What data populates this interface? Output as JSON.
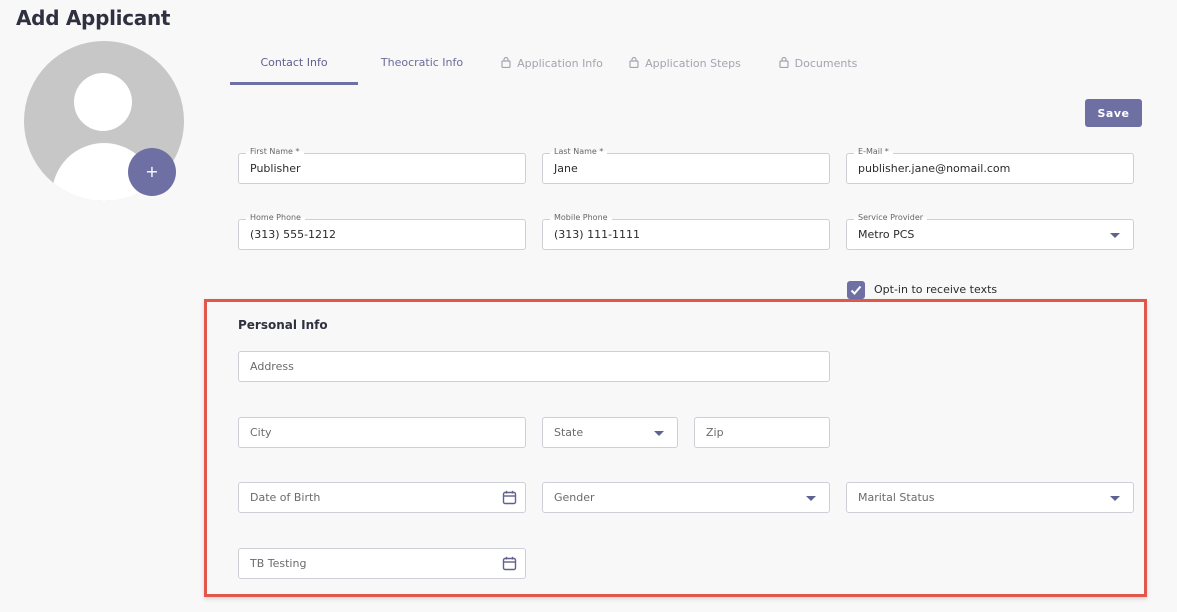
{
  "page": {
    "title": "Add Applicant"
  },
  "avatar": {
    "add_label": "+"
  },
  "tabs": [
    {
      "label": "Contact Info",
      "state": "active"
    },
    {
      "label": "Theocratic Info",
      "state": "normal"
    },
    {
      "label": "Application Info",
      "state": "locked"
    },
    {
      "label": "Application Steps",
      "state": "locked"
    },
    {
      "label": "Documents",
      "state": "locked"
    }
  ],
  "save_label": "Save",
  "contact": {
    "first_name": {
      "label": "First Name *",
      "value": "Publisher"
    },
    "last_name": {
      "label": "Last Name *",
      "value": "Jane"
    },
    "email": {
      "label": "E-Mail *",
      "value": "publisher.jane@nomail.com"
    },
    "home_phone": {
      "label": "Home Phone",
      "value": "(313) 555-1212"
    },
    "mobile_phone": {
      "label": "Mobile Phone",
      "value": "(313) 111-1111"
    },
    "service_provider": {
      "label": "Service Provider",
      "value": "Metro PCS"
    },
    "opt_in": {
      "label": "Opt-in to receive texts",
      "checked": true
    }
  },
  "personal": {
    "title": "Personal Info",
    "address_placeholder": "Address",
    "city_placeholder": "City",
    "state_placeholder": "State",
    "zip_placeholder": "Zip",
    "dob_placeholder": "Date of Birth",
    "gender_placeholder": "Gender",
    "marital_placeholder": "Marital Status",
    "tb_placeholder": "TB Testing"
  },
  "colors": {
    "accent": "#6e6fa3",
    "highlight": "#e2574c",
    "background": "#f8f8f8"
  },
  "icons": {
    "lock": "lock-icon",
    "calendar": "calendar-icon",
    "dropdown": "chevron-down-icon",
    "avatar": "user-avatar-icon"
  }
}
